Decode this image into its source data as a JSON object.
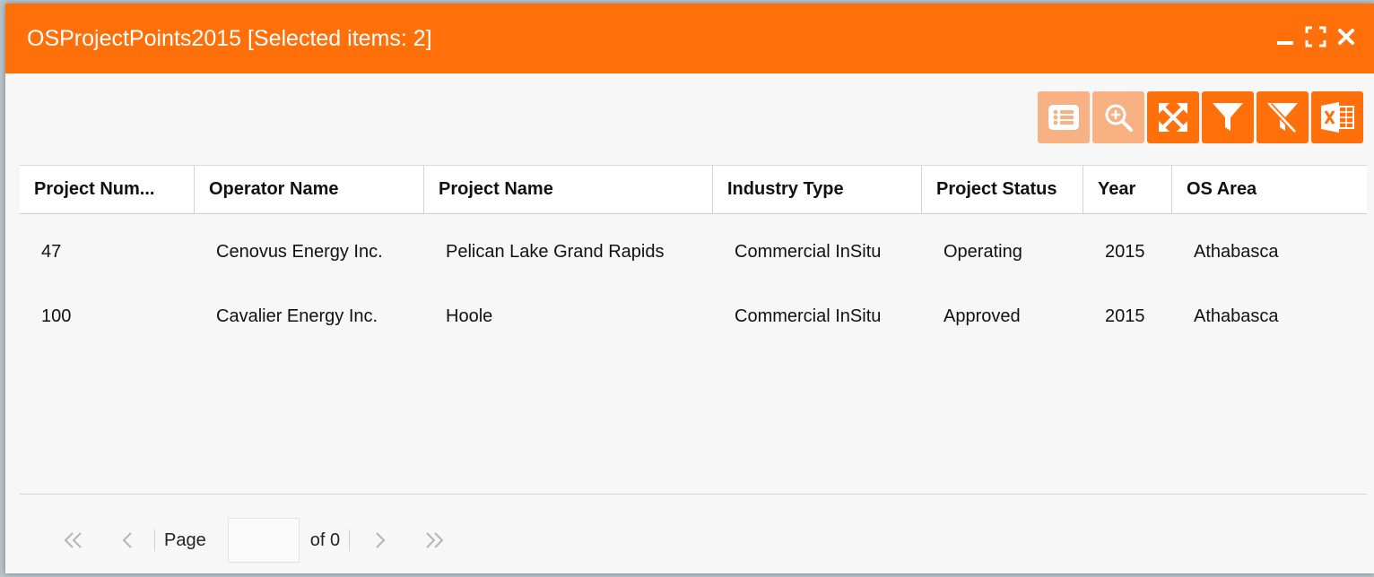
{
  "window": {
    "title": "OSProjectPoints2015 [Selected items: 2]",
    "accent_color": "#ff6f0a"
  },
  "window_controls": [
    "minimize-icon",
    "maximize-icon",
    "close-icon"
  ],
  "toolbar": [
    {
      "icon": "list-icon",
      "enabled": false
    },
    {
      "icon": "zoom-to-icon",
      "enabled": false
    },
    {
      "icon": "expand-arrows-icon",
      "enabled": true
    },
    {
      "icon": "filter-icon",
      "enabled": true
    },
    {
      "icon": "clear-filter-icon",
      "enabled": true
    },
    {
      "icon": "excel-export-icon",
      "enabled": true
    }
  ],
  "table": {
    "headers": [
      "Project Num...",
      "Operator Name",
      "Project Name",
      "Industry Type",
      "Project Status",
      "Year",
      "OS Area"
    ],
    "rows": [
      [
        "47",
        "Cenovus Energy Inc.",
        "Pelican Lake Grand Rapids",
        "Commercial InSitu",
        "Operating",
        "2015",
        "Athabasca"
      ],
      [
        "100",
        "Cavalier Energy Inc.",
        "Hoole",
        "Commercial InSitu",
        "Approved",
        "2015",
        "Athabasca"
      ]
    ]
  },
  "pager": {
    "page_label": "Page",
    "page_value": "",
    "of_label": "of 0"
  }
}
